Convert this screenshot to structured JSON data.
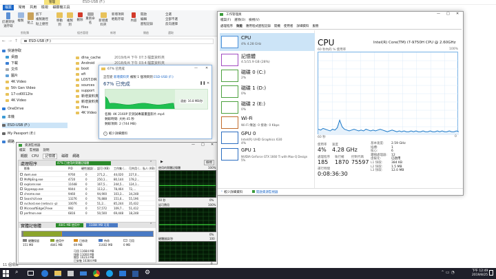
{
  "explorer": {
    "title": "ESD-USB (F:)",
    "ribbon_tabs": [
      "檔案",
      "常用",
      "共用",
      "檢視",
      "磁碟機工具"
    ],
    "context_tab": "管理",
    "ribbon_buttons": [
      "釘選到快速存取",
      "複製",
      "貼上",
      "剪下",
      "複製路徑",
      "貼上捷徑",
      "移動到",
      "複製到",
      "刪除",
      "重新命名",
      "新增資料夾",
      "新增項目",
      "輕鬆存取",
      "內容",
      "開啟",
      "編輯",
      "歷程記錄",
      "全選",
      "全部不選",
      "反向選擇"
    ],
    "ribbon_groups": [
      "剪貼簿",
      "組合管理",
      "新增",
      "開啟",
      "選取"
    ],
    "address": "ESD-USB (F:)",
    "nav": [
      "快速存取",
      "桌面",
      "下載",
      "文件",
      "圖片",
      "4K Video",
      "5th Gen Video",
      "17-cd0012tx",
      "4K Video",
      "OneDrive",
      "本機",
      "ESD-USB (F:)",
      "My Passport (E:)",
      "網路"
    ],
    "files": [
      {
        "name": "dlna_cache",
        "date": "2019/6/4 下午 07:3",
        "type": "檔案資料夾"
      },
      {
        "name": "Android",
        "date": "2018/6/4 下午 03:4",
        "type": "檔案資料夾"
      },
      {
        "name": "boot",
        "date": "",
        "type": "檔案資料夾"
      },
      {
        "name": "efi",
        "date": "",
        "type": "檔案資料夾"
      },
      {
        "name": "LOST.DIR",
        "date": "",
        "type": "檔案資料夾"
      },
      {
        "name": "sources",
        "date": "",
        "type": "檔案資料夾"
      },
      {
        "name": "support",
        "date": "",
        "type": "檔案資料夾"
      },
      {
        "name": "新增資料夾",
        "date": "",
        "type": "檔案資料夾"
      },
      {
        "name": "新增資料夾 (2)",
        "date": "",
        "type": "檔案資料夾"
      },
      {
        "name": "files",
        "date": "",
        "type": "檔案資料夾"
      },
      {
        "name": "4K Video",
        "date": "",
        "type": "檔案資料夾"
      }
    ],
    "status": "11 個項目"
  },
  "copy": {
    "title": "67% 已完成",
    "line1_prefix": "正在從",
    "line1_src": "新增資料夾",
    "line1_mid": "複製 1 個項目到",
    "line1_dst": "ESD-USB (F:)",
    "heading": "67% 已完成",
    "speed": "速度: 16.8 MB/秒",
    "name": "名稱: 4K 2160P 於測試專屬畫面影片.mp4",
    "remaining": "剩餘時間: 大約 45 秒",
    "items": "剩餘項目: 2 (744 MB)",
    "fewer": "較少詳細資料",
    "progress": 0.67
  },
  "resmon": {
    "title": "資源監視器",
    "menu": [
      "檔案",
      "監視器",
      "說明"
    ],
    "tabs": [
      "概觀",
      "CPU",
      "記憶體",
      "磁碟",
      "網路"
    ],
    "proc_header": "處理程序",
    "proc_badge": "47% 已使用的實體記憶體",
    "cols": [
      "影像",
      "PID",
      "硬性錯誤/...",
      "認可 (KB)",
      "工作集 (...",
      "可共用 (...",
      "私人 (KB)"
    ],
    "rows": [
      {
        "name": "dwm.exe",
        "pid": "9760",
        "hf": "0",
        "commit": "271,2...",
        "ws": "44,020",
        "share": "227,0..."
      },
      {
        "name": "MsMpEng.exe",
        "pid": "4720",
        "hf": "0",
        "commit": "250,1...",
        "ws": "80,144",
        "share": "178,2..."
      },
      {
        "name": "explorer.exe",
        "pid": "11648",
        "hf": "0",
        "commit": "167,5...",
        "ws": "244,5...",
        "share": "124,1..."
      },
      {
        "name": "Skypeapp.exe",
        "pid": "9044",
        "hf": "0",
        "commit": "113,2...",
        "ws": "78,464",
        "share": "72,..."
      },
      {
        "name": "chrome.exe",
        "pid": "9460",
        "hf": "0",
        "commit": "94,900",
        "ws": "103,3...",
        "share": "34,248"
      },
      {
        "name": "SearchUI.exe",
        "pid": "13276",
        "hf": "0",
        "commit": "76,888",
        "ws": "151,6...",
        "share": "55,196"
      },
      {
        "name": "svchost.exe (netsvcs -p)",
        "pid": "10076",
        "hf": "0",
        "commit": "51,2...",
        "ws": "85,244",
        "share": "35,432"
      },
      {
        "name": "MicrosoftEdgeCP.exe",
        "pid": "992",
        "hf": "0",
        "commit": "57,572",
        "ws": "109,7...",
        "share": "51,412"
      },
      {
        "name": "perfmon.exe",
        "pid": "6816",
        "hf": "0",
        "commit": "50,500",
        "ws": "69,448",
        "share": "18,248"
      }
    ],
    "mem_header": "實體記憶體",
    "mem_badge_used": "4841 MB 使用中",
    "mem_badge_free": "11884 MB 可用",
    "legend": [
      "硬體保留",
      "使用中",
      "已修改",
      "待命",
      "可用"
    ],
    "legend_vals": [
      "151 MB",
      "4841 MB",
      "69 MB",
      "11602 MB",
      "0 MB"
    ],
    "legend_colors": [
      "#808080",
      "#8ba42c",
      "#d98b1a",
      "#4a7ac4",
      "#e5e5e5"
    ],
    "mem_stats": [
      "可用 11684 MB",
      "快取 11000 MB",
      "總計 16233 MB",
      "已安裝 16384 MB"
    ],
    "view_btn": "檢視",
    "graph_labels": [
      "使用的實體記憶體",
      "100%",
      "60 秒",
      "0%",
      "認可費用",
      "100%",
      "0%",
      "硬體錯誤/秒",
      "100",
      "0"
    ]
  },
  "taskmgr": {
    "title": "工作管理員",
    "menu": [
      "檔案(F)",
      "選項(O)",
      "檢視(V)"
    ],
    "tabs": [
      "處理程序",
      "效能",
      "應用程式歷程記錄",
      "開機",
      "使用者",
      "詳細資料",
      "服務"
    ],
    "items": [
      {
        "title": "CPU",
        "sub": "4% 4.28 GHz"
      },
      {
        "title": "記憶體",
        "sub": "4.5/15.9 GB (28%)"
      },
      {
        "title": "磁碟 0 (C:)",
        "sub": "2%"
      },
      {
        "title": "磁碟 1 (D:)",
        "sub": "0%"
      },
      {
        "title": "磁碟 2 (E:)",
        "sub": "0%"
      },
      {
        "title": "Wi-Fi",
        "sub": "Wi-Fi 傳送: 0 接收: 0 Kbps"
      },
      {
        "title": "GPU 0",
        "sub": "Intel(R) UHD Graphics 630\n4%"
      },
      {
        "title": "GPU 1",
        "sub": "NVIDIA GeForce GTX 1660 Ti with Max-Q Design\n5%"
      }
    ],
    "cpu_title": "CPU",
    "cpu_model": "Intel(R) Core(TM) i7-9750H CPU @ 2.60GHz",
    "graph_caption": "60 秒內的 % 使用率",
    "graph_max": "100%",
    "graph_60": "60 秒",
    "graph_zero": "0",
    "stats": [
      {
        "label": "使用率",
        "value": "4%"
      },
      {
        "label": "速度",
        "value": "4.28 GHz"
      },
      {
        "label": "處理程序",
        "value": "185"
      },
      {
        "label": "執行緒",
        "value": "1870"
      },
      {
        "label": "控制代碼",
        "value": "75597"
      },
      {
        "label": "運行時間",
        "value": "0:08:36:30"
      }
    ],
    "specs": [
      {
        "k": "基本速度:",
        "v": "2.59 GHz"
      },
      {
        "k": "插槽:",
        "v": "1"
      },
      {
        "k": "核心:",
        "v": "6"
      },
      {
        "k": "邏輯處理器:",
        "v": "12"
      },
      {
        "k": "虛擬化:",
        "v": "已啟用"
      },
      {
        "k": "L1 快取:",
        "v": "384 KB"
      },
      {
        "k": "L2 快取:",
        "v": "1.5 MB"
      },
      {
        "k": "L3 快取:",
        "v": "12.0 MB"
      }
    ],
    "fewer": "較少詳細資料",
    "open_resmon": "開啟資源監視器"
  },
  "taskbar": {
    "time": "下午 12:49",
    "date": "2019/8/25",
    "icons": [
      "windows-start",
      "search",
      "task-view",
      "edge",
      "explorer",
      "store",
      "mail",
      "chrome",
      "skype",
      "photos",
      "word",
      "settings"
    ]
  }
}
